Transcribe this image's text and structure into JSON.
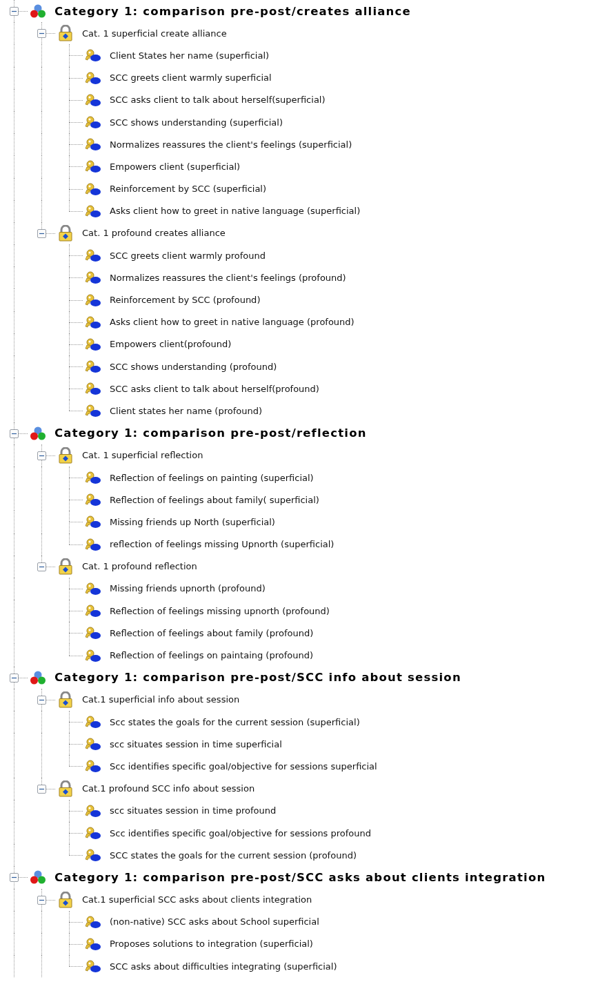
{
  "tree": [
    {
      "kind": "category",
      "label": "Category 1: comparison pre-post/creates alliance",
      "expanded": true,
      "children": [
        {
          "kind": "subcategory",
          "label": "Cat. 1 superficial create alliance",
          "expanded": true,
          "children": [
            {
              "kind": "code",
              "label": "Client States her name (superficial)"
            },
            {
              "kind": "code",
              "label": "SCC greets client warmly superficial"
            },
            {
              "kind": "code",
              "label": "SCC asks client to talk about herself(superficial)"
            },
            {
              "kind": "code",
              "label": "SCC shows understanding (superficial)"
            },
            {
              "kind": "code",
              "label": "Normalizes reassures the client's feelings (superficial)"
            },
            {
              "kind": "code",
              "label": "Empowers client (superficial)"
            },
            {
              "kind": "code",
              "label": "Reinforcement by SCC (superficial)"
            },
            {
              "kind": "code",
              "label": "Asks client how to greet in native language (superficial)"
            }
          ]
        },
        {
          "kind": "subcategory",
          "label": "Cat. 1 profound creates alliance",
          "expanded": true,
          "children": [
            {
              "kind": "code",
              "label": "SCC greets client warmly profound"
            },
            {
              "kind": "code",
              "label": "Normalizes reassures the client's feelings (profound)"
            },
            {
              "kind": "code",
              "label": "Reinforcement by SCC (profound)"
            },
            {
              "kind": "code",
              "label": "Asks client how to greet in native language (profound)"
            },
            {
              "kind": "code",
              "label": "Empowers client(profound)"
            },
            {
              "kind": "code",
              "label": "SCC shows understanding (profound)"
            },
            {
              "kind": "code",
              "label": "SCC asks client to talk about herself(profound)"
            },
            {
              "kind": "code",
              "label": "Client states her name (profound)"
            }
          ]
        }
      ]
    },
    {
      "kind": "category",
      "label": "Category 1: comparison pre-post/reflection",
      "expanded": true,
      "children": [
        {
          "kind": "subcategory",
          "label": "Cat. 1 superficial reflection",
          "expanded": true,
          "children": [
            {
              "kind": "code",
              "label": "Reflection of feelings on painting (superficial)"
            },
            {
              "kind": "code",
              "label": "Reflection of feelings about family( superficial)"
            },
            {
              "kind": "code",
              "label": "Missing friends up North (superficial)"
            },
            {
              "kind": "code",
              "label": "reflection of feelings missing Upnorth (superficial)"
            }
          ]
        },
        {
          "kind": "subcategory",
          "label": "Cat. 1 profound reflection",
          "expanded": true,
          "children": [
            {
              "kind": "code",
              "label": "Missing friends upnorth (profound)"
            },
            {
              "kind": "code",
              "label": "Reflection of feelings missing upnorth (profound)"
            },
            {
              "kind": "code",
              "label": "Reflection of feelings about family (profound)"
            },
            {
              "kind": "code",
              "label": "Reflection of feelings on paintaing (profound)"
            }
          ]
        }
      ]
    },
    {
      "kind": "category",
      "label": "Category 1: comparison pre-post/SCC info about session",
      "expanded": true,
      "children": [
        {
          "kind": "subcategory",
          "label": "Cat.1 superficial info about session",
          "expanded": true,
          "children": [
            {
              "kind": "code",
              "label": "Scc states the goals for the current session (superficial)"
            },
            {
              "kind": "code",
              "label": "scc situates session in time superficial"
            },
            {
              "kind": "code",
              "label": "Scc identifies specific goal/objective for sessions superficial"
            }
          ]
        },
        {
          "kind": "subcategory",
          "label": "Cat.1 profound SCC info about session",
          "expanded": true,
          "children": [
            {
              "kind": "code",
              "label": "scc situates session in time profound"
            },
            {
              "kind": "code",
              "label": "Scc identifies specific goal/objective for sessions profound"
            },
            {
              "kind": "code",
              "label": "SCC states the goals for the current session (profound)"
            }
          ]
        }
      ]
    },
    {
      "kind": "category",
      "label": "Category 1: comparison pre-post/SCC asks about clients integration",
      "expanded": true,
      "continues": true,
      "children": [
        {
          "kind": "subcategory",
          "label": "Cat.1 superficial SCC asks about clients integration",
          "expanded": true,
          "continues": true,
          "children": [
            {
              "kind": "code",
              "label": "(non-native) SCC asks about School superficial"
            },
            {
              "kind": "code",
              "label": "Proposes solutions to integration (superficial)"
            },
            {
              "kind": "code",
              "label": "SCC asks about difficulties integrating (superficial)"
            }
          ]
        }
      ]
    }
  ]
}
